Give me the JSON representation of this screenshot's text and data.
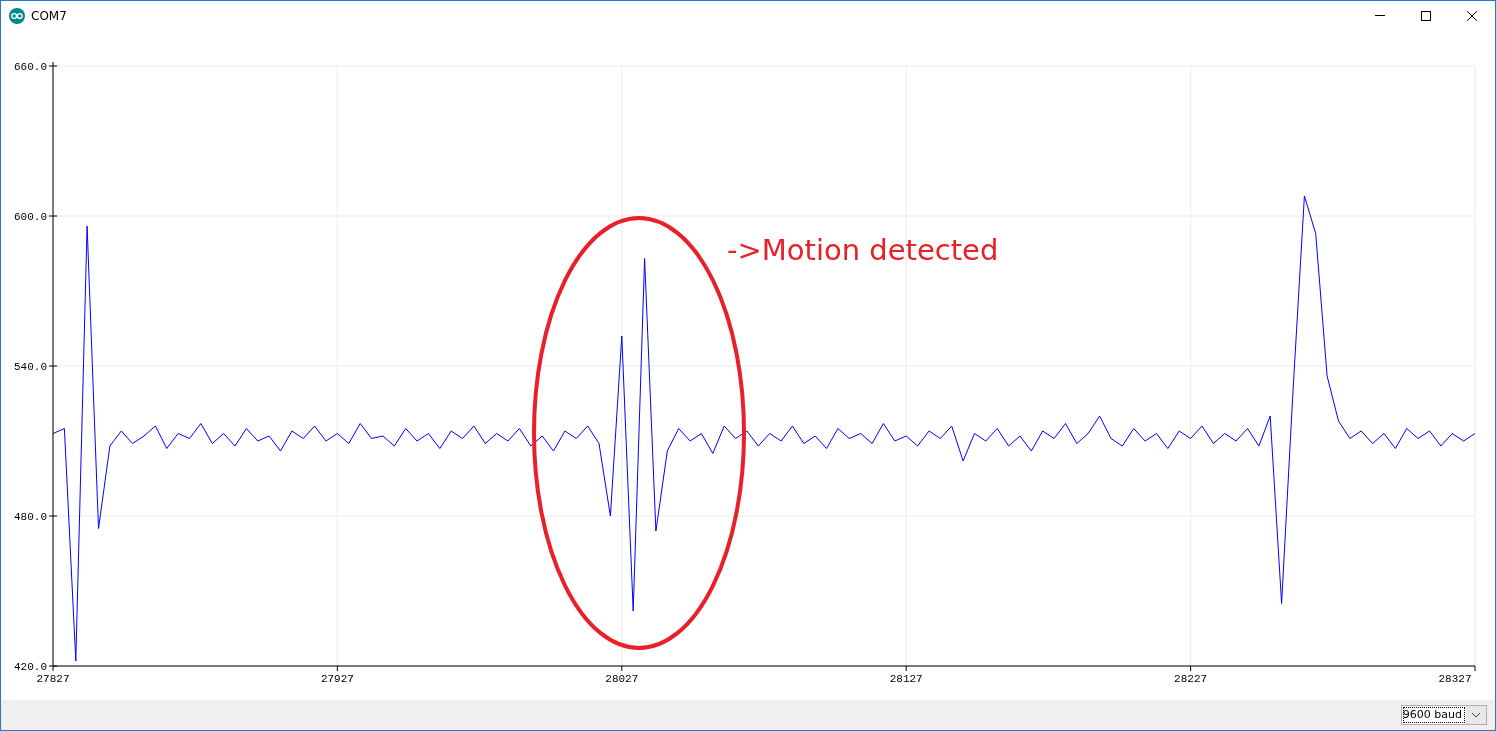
{
  "window": {
    "title": "COM7"
  },
  "plot": {
    "chart_data": {
      "type": "line",
      "xlim": [
        27827,
        28327
      ],
      "ylim": [
        420,
        660
      ],
      "grid": true,
      "xticks": [
        27827,
        27927,
        28027,
        28127,
        28227,
        28327
      ],
      "yticks": [
        {
          "value": 420,
          "label": "420.0"
        },
        {
          "value": 480,
          "label": "480.0"
        },
        {
          "value": 540,
          "label": "540.0"
        },
        {
          "value": 600,
          "label": "600.0"
        },
        {
          "value": 660,
          "label": "660.0"
        }
      ],
      "x": [
        27827,
        27831,
        27835,
        27839,
        27843,
        27847,
        27851,
        27855,
        27859,
        27863,
        27867,
        27871,
        27875,
        27879,
        27883,
        27887,
        27891,
        27895,
        27899,
        27903,
        27907,
        27911,
        27915,
        27919,
        27923,
        27927,
        27931,
        27935,
        27939,
        27943,
        27947,
        27951,
        27955,
        27959,
        27963,
        27967,
        27971,
        27975,
        27979,
        27983,
        27987,
        27991,
        27995,
        27999,
        28003,
        28007,
        28011,
        28015,
        28019,
        28023,
        28027,
        28031,
        28035,
        28039,
        28043,
        28047,
        28051,
        28055,
        28059,
        28063,
        28067,
        28071,
        28075,
        28079,
        28083,
        28087,
        28091,
        28095,
        28099,
        28103,
        28107,
        28111,
        28115,
        28119,
        28123,
        28127,
        28131,
        28135,
        28139,
        28143,
        28147,
        28151,
        28155,
        28159,
        28163,
        28167,
        28171,
        28175,
        28179,
        28183,
        28187,
        28191,
        28195,
        28199,
        28203,
        28207,
        28211,
        28215,
        28219,
        28223,
        28227,
        28231,
        28235,
        28239,
        28243,
        28247,
        28251,
        28255,
        28259,
        28263,
        28267,
        28271,
        28275,
        28279,
        28283,
        28287,
        28291,
        28295,
        28299,
        28303,
        28307,
        28311,
        28315,
        28319,
        28323,
        28327
      ],
      "series": [
        {
          "color": "#0000ff",
          "values": [
            513,
            515,
            422,
            596,
            475,
            508,
            514,
            509,
            512,
            516,
            507,
            513,
            511,
            517,
            509,
            513,
            508,
            515,
            510,
            512,
            506,
            514,
            511,
            516,
            510,
            513,
            509,
            517,
            511,
            512,
            508,
            515,
            510,
            513,
            507,
            514,
            511,
            516,
            509,
            513,
            510,
            515,
            508,
            512,
            506,
            514,
            511,
            516,
            509,
            480,
            552,
            442,
            583,
            474,
            506,
            515,
            510,
            513,
            505,
            516,
            511,
            514,
            508,
            513,
            510,
            516,
            509,
            512,
            507,
            515,
            511,
            513,
            509,
            517,
            510,
            512,
            508,
            514,
            511,
            516,
            502,
            513,
            510,
            515,
            508,
            512,
            506,
            514,
            511,
            517,
            509,
            513,
            520,
            511,
            508,
            515,
            510,
            513,
            507,
            514,
            511,
            516,
            509,
            513,
            510,
            515,
            508,
            520,
            445,
            530,
            608,
            593,
            536,
            518,
            511,
            514,
            509,
            513,
            507,
            515,
            511,
            514,
            508,
            513,
            510,
            513
          ]
        }
      ],
      "annotations": [
        "->Motion detected"
      ]
    }
  },
  "status_bar": {
    "baud_select": {
      "value": "9600 baud"
    }
  }
}
